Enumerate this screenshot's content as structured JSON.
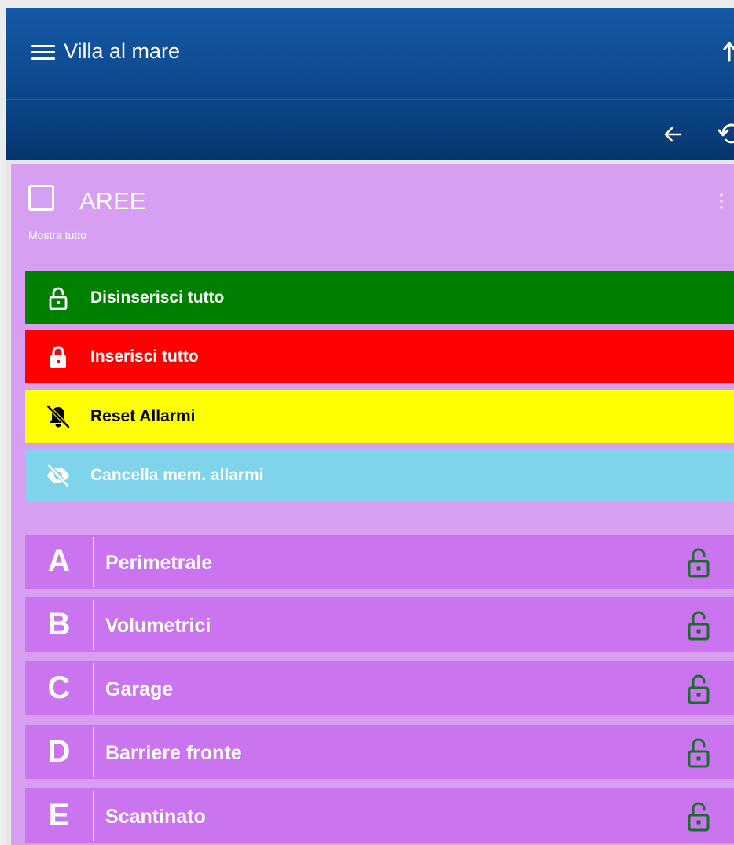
{
  "header": {
    "title": "Villa al mare"
  },
  "card": {
    "title": "AREE",
    "subtitle": "Mostra tutto"
  },
  "actions": [
    {
      "label": "Disinserisci tutto",
      "icon": "lock-open-icon",
      "bg": "#008000",
      "fg": "#ffffff"
    },
    {
      "label": "Inserisci tutto",
      "icon": "lock-closed-icon",
      "bg": "#ff0000",
      "fg": "#ffffff"
    },
    {
      "label": "Reset Allarmi",
      "icon": "bell-off-icon",
      "bg": "#ffff00",
      "fg": "#000000"
    },
    {
      "label": "Cancella mem. allarmi",
      "icon": "eye-off-icon",
      "bg": "#7fd4ec",
      "fg": "#ffffff"
    }
  ],
  "areas": [
    {
      "letter": "A",
      "name": "Perimetrale",
      "status_icon": "lock-open-icon"
    },
    {
      "letter": "B",
      "name": "Volumetrici",
      "status_icon": "lock-open-icon"
    },
    {
      "letter": "C",
      "name": "Garage",
      "status_icon": "lock-open-icon"
    },
    {
      "letter": "D",
      "name": "Barriere fronte",
      "status_icon": "lock-open-icon"
    },
    {
      "letter": "E",
      "name": "Scantinato",
      "status_icon": "lock-open-icon"
    }
  ],
  "colors": {
    "header_top": "#1559a6",
    "header_bottom": "#073670",
    "card_bg": "#d69ff2",
    "area_bg": "#ca74ef",
    "area_lock": "#1f6b2f"
  }
}
